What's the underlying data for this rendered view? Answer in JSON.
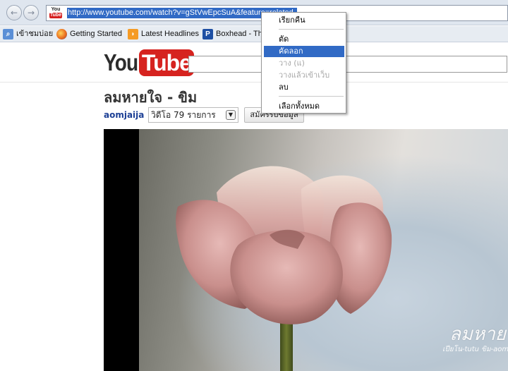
{
  "browser": {
    "back_label": "←",
    "forward_label": "→",
    "site_icon": {
      "you": "You",
      "tube": "Tube"
    },
    "url": "http://www.youtube.com/watch?v=gStVwEpcSuA&feature=related"
  },
  "bookmarks": [
    {
      "label": "เข้าชมบ่อย",
      "icon": "magnifier-icon",
      "icon_glyph": "⌕"
    },
    {
      "label": "Getting Started",
      "icon": "firefox-icon",
      "icon_glyph": ""
    },
    {
      "label": "Latest Headlines",
      "icon": "rss-icon",
      "icon_glyph": "◗"
    },
    {
      "label": "Boxhead - Th",
      "icon": "boxhead-icon",
      "icon_glyph": "P"
    }
  ],
  "youtube": {
    "logo_you": "You",
    "logo_tube": "Tube",
    "video_title": "ลมหายใจ - ขิม",
    "channel": "aomjaija",
    "playlist": "วิดีโอ 79 รายการ",
    "subscribe": "สมัครรับข้อมูล"
  },
  "video": {
    "watermark_title": "ลมหายใจ",
    "watermark_sub": "เปียโน-tutu ขิม-aom"
  },
  "context_menu": {
    "items": [
      {
        "label": "เรียกคืน",
        "state": "normal"
      },
      {
        "label": "ตัด",
        "state": "normal"
      },
      {
        "label": "คัดลอก",
        "state": "active"
      },
      {
        "label": "วาง (แ)",
        "state": "disabled"
      },
      {
        "label": "วางแล้วเข้าเว็บ",
        "state": "disabled"
      },
      {
        "label": "ลบ",
        "state": "normal"
      },
      {
        "label": "เลือกทั้งหมด",
        "state": "normal"
      }
    ]
  },
  "colors": {
    "selection": "#316ac5",
    "youtube_red": "#d6231f",
    "channel_link": "#1c3f95"
  }
}
